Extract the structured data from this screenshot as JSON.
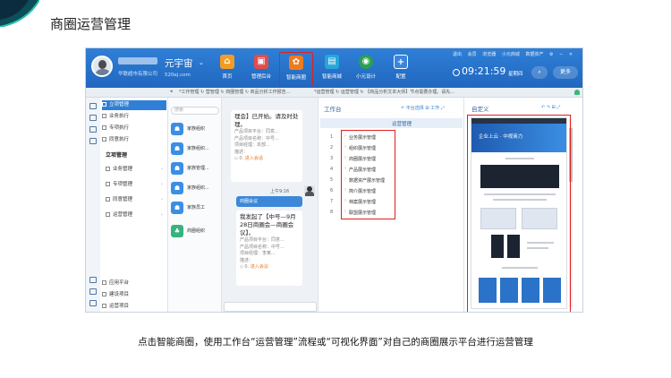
{
  "slide": {
    "title": "商圈运营管理",
    "caption": "点击智能商圈，使用工作台“运营管理”流程或“可视化界面”对自己的商圈展示平台进行运营管理"
  },
  "header": {
    "user_sub": "华联超市有限公司",
    "brand": "元宇宙",
    "brand_sub": "520ej.com",
    "apps": [
      {
        "label": "首页",
        "color": "#f39c25",
        "glyph": "⌂"
      },
      {
        "label": "管理后台",
        "color": "#e34c4c",
        "glyph": "▣"
      },
      {
        "label": "智能商圈",
        "color": "#ef7b1f",
        "glyph": "✿"
      },
      {
        "label": "智能商城",
        "color": "#26a6d9",
        "glyph": "▤"
      },
      {
        "label": "小元设计",
        "color": "#2aa14f",
        "glyph": "◉"
      },
      {
        "label": "配置",
        "color": "#3b86dc",
        "glyph": "+"
      }
    ],
    "toplinks": [
      "退出",
      "会员",
      "浏览器",
      "小元商城",
      "数据资产",
      "⚙",
      "−",
      "✕"
    ],
    "clock": "09:21:59",
    "weekday": "星期四",
    "search_glyph": "⌕",
    "more_label": "更多"
  },
  "tabs": {
    "arrow": "◂",
    "left": "*工作管理 ↻ 营管理 ↻ 商圈管理 ↻ 商品分析工作报告...",
    "right": "*运营管理 ↻ 运营管理 ↻ 【商品分析文本大师】节点需要办理。请先..."
  },
  "sidebar": {
    "top_items": [
      {
        "label": "立项管理",
        "active": true
      },
      {
        "label": "业务执行",
        "active": false
      },
      {
        "label": "专项执行",
        "active": false
      },
      {
        "label": "同意执行",
        "active": false
      }
    ],
    "section": "立项管理",
    "sub_items": [
      "业务管理",
      "专项管理",
      "同意管理",
      "运营管理"
    ],
    "bottom_items": [
      "应用平台",
      "建设项目",
      "运营项目"
    ]
  },
  "chat_list": {
    "search_placeholder": "搜索",
    "groups": [
      {
        "label": "家族组织",
        "color": "#3a8ee6",
        "glyph": "☗"
      },
      {
        "label": "家族组织...",
        "color": "#3a8ee6",
        "glyph": "☗"
      },
      {
        "label": "家族管理...",
        "color": "#3a8ee6",
        "glyph": "☗"
      },
      {
        "label": "家族组织...",
        "color": "#3a8ee6",
        "glyph": "☗"
      },
      {
        "label": "家族员工",
        "color": "#3a8ee6",
        "glyph": "☗"
      },
      {
        "label": "商圈组织",
        "color": "#36b37e",
        "glyph": "♣"
      }
    ]
  },
  "chat": {
    "msg1_big": "理会】已开始。请及时处理。",
    "msg1_lines": [
      "产品项目平台：同意...",
      "产品项目名称：中号...",
      "项目经理：本部...",
      "描述：",
      "◇ 0."
    ],
    "msg1_link": "进入会话",
    "time": "上午9:16",
    "tag": "商圈会议",
    "msg2_big": "我发起了【中号—9月28日商圈会—商圈会议】。",
    "msg2_lines": [
      "产品项目平台：同意...",
      "产品项目名称：中号...",
      "项目经理：李某...",
      "描述：",
      "◇ 0."
    ],
    "msg2_link": "进入会议"
  },
  "workbench": {
    "title": "工作台",
    "tools": "↶ 平台选择  ⊞ 工作  ⤢",
    "column": "运营管理",
    "rows": [
      {
        "n": "1",
        "label": "业务展示管理"
      },
      {
        "n": "2",
        "label": "组织展示管理"
      },
      {
        "n": "3",
        "label": "商圈展示管理"
      },
      {
        "n": "4",
        "label": "产品展示管理"
      },
      {
        "n": "5",
        "label": "数据资产展示管理"
      },
      {
        "n": "6",
        "label": "简介展示管理"
      },
      {
        "n": "7",
        "label": "档案展示管理"
      },
      {
        "n": "8",
        "label": "联盟展示管理"
      }
    ]
  },
  "custom": {
    "title": "自定义",
    "tools": "↶ ↷ ⊞ ⤢",
    "hero": "企业上云 · 中视商力"
  }
}
